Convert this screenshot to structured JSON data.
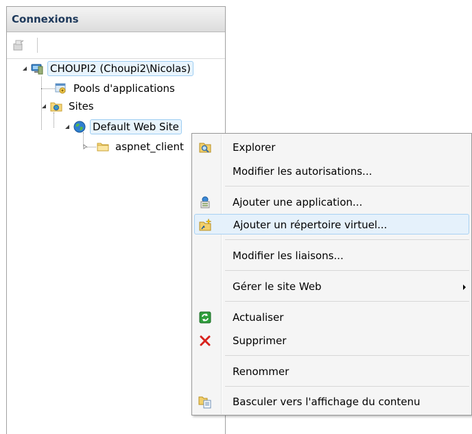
{
  "panel": {
    "title": "Connexions"
  },
  "tree": {
    "server": "CHOUPI2 (Choupi2\\Nicolas)",
    "app_pools": "Pools d'applications",
    "sites": "Sites",
    "default_site": "Default Web Site",
    "folder": "aspnet_client"
  },
  "menu": {
    "explorer": "Explorer",
    "edit_permissions": "Modifier les autorisations...",
    "add_application": "Ajouter une application...",
    "add_virtual_dir": "Ajouter un répertoire virtuel...",
    "edit_bindings": "Modifier les liaisons...",
    "manage_site": "Gérer le site Web",
    "refresh": "Actualiser",
    "delete": "Supprimer",
    "rename": "Renommer",
    "switch_content_view": "Basculer vers l'affichage du contenu"
  },
  "colors": {
    "selection": "#e5f1fb",
    "header_text": "#1e395b",
    "delete_red": "#d8221c"
  }
}
